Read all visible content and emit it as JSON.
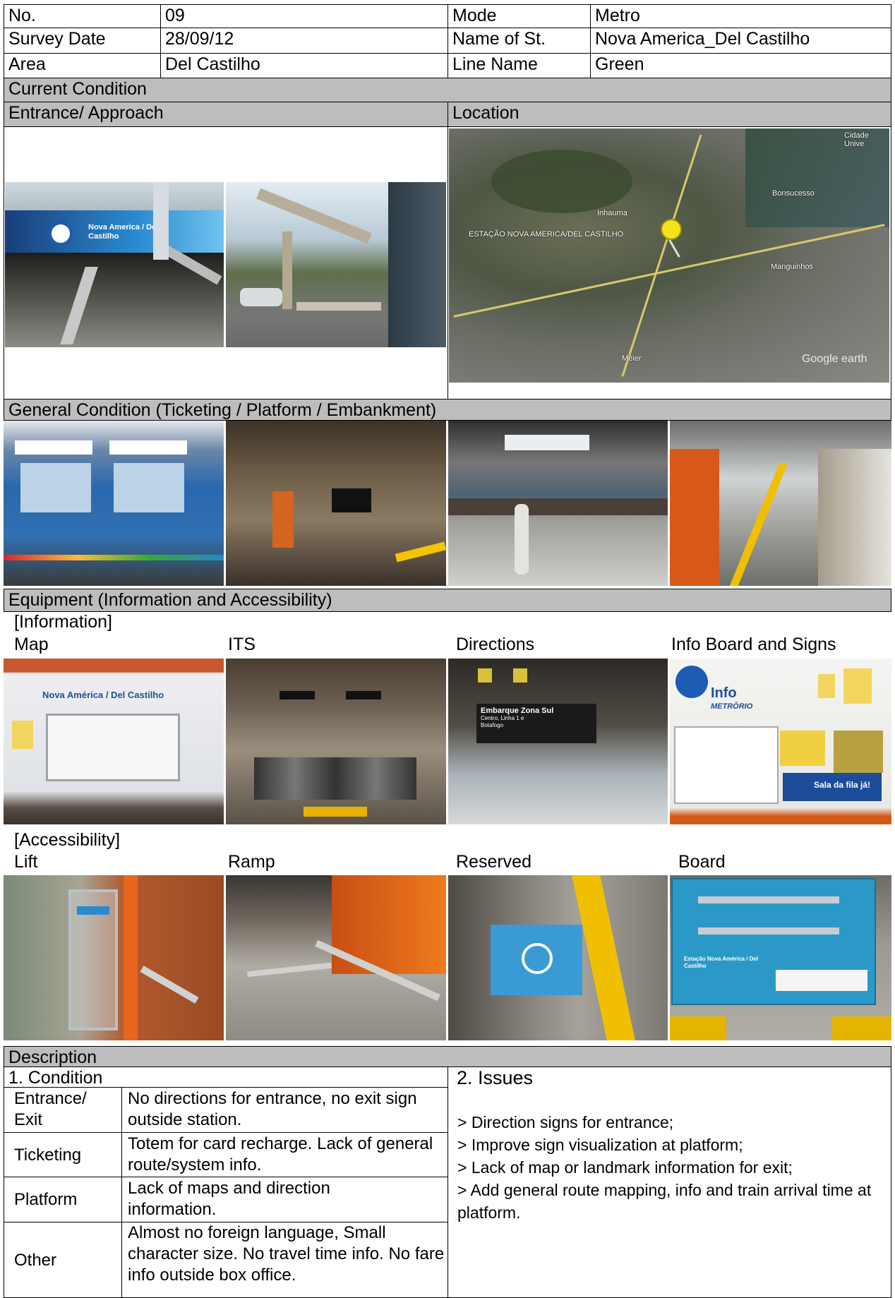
{
  "header": {
    "no_label": "No.",
    "no_value": "09",
    "mode_label": "Mode",
    "mode_value": "Metro",
    "date_label": "Survey Date",
    "date_value": "28/09/12",
    "station_label": "Name of St.",
    "station_value": "Nova America_Del Castilho",
    "area_label": "Area",
    "area_value": "Del Castilho",
    "line_label": "Line Name",
    "line_value": "Green"
  },
  "sections": {
    "current_condition": "Current Condition",
    "entrance_approach": "Entrance/ Approach",
    "location": "Location",
    "general_condition": "General Condition (Ticketing / Platform / Embankment)",
    "equipment": "Equipment (Information  and Accessibility)",
    "description": "Description"
  },
  "photos": {
    "entrance_sign_text": "Nova America / Del Castilho",
    "map_places": [
      "ESTAÇÃO NOVA AMERICA/DEL CASTILHO",
      "Inhauma",
      "Bonsucesso",
      "Manguinhos",
      "Méier",
      "Cidade Unive",
      "Google earth"
    ],
    "info_map_title": "Nova América / Del Castilho",
    "directions_sign": "Embarque Zona Sul",
    "directions_sign_sub": "Centro, Linha 1 e Botafogo",
    "info_board_title": "Info",
    "info_board_brand": "METRÔRIO",
    "info_board_banner": "Sala da fila já!",
    "board_text": "Estação Nova América / Del Castilho"
  },
  "information": {
    "heading": "[Information]",
    "labels": [
      "Map",
      "ITS",
      "Directions",
      "Info  Board  and  Signs"
    ]
  },
  "accessibility": {
    "heading": "[Accessibility]",
    "labels": [
      "Lift",
      "Ramp",
      "Reserved",
      "Board"
    ]
  },
  "description": {
    "condition_title": "1.   Condition",
    "issues_title": "2.   Issues",
    "rows": [
      {
        "label": "Entrance/ Exit",
        "text": "No directions for entrance, no exit sign outside station."
      },
      {
        "label": "Ticketing",
        "text": "Totem  for card recharge.  Lack of general route/system info."
      },
      {
        "label": "Platform",
        "text": "Lack of maps and direction information."
      },
      {
        "label": "Other",
        "text": "Almost no foreign  language, Small character size. No travel time info. No fare info outside box office."
      }
    ],
    "issues": [
      "> Direction signs for entrance;",
      "> Improve  sign visualization at platform;",
      "> Lack of map or landmark information  for exit;",
      "> Add general route mapping, info and train arrival time at platform."
    ]
  }
}
